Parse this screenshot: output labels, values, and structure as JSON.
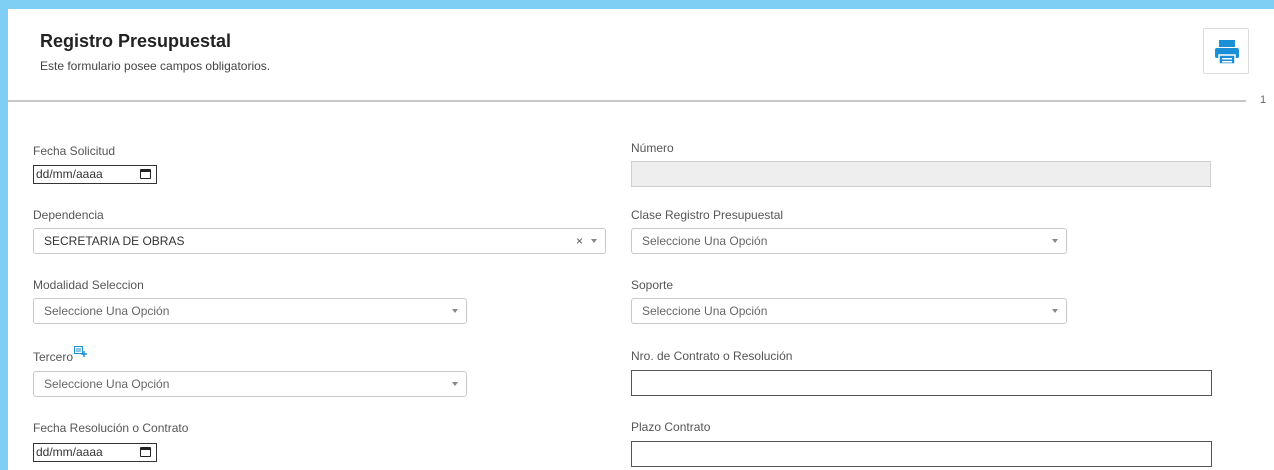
{
  "header": {
    "title": "Registro Presupuestal",
    "subtitle": "Este formulario posee campos obligatorios.",
    "page_number": "1",
    "print_icon": "printer-icon"
  },
  "form": {
    "fecha_solicitud": {
      "label": "Fecha Solicitud",
      "value": "dd/mm/aaaa"
    },
    "numero": {
      "label": "Número",
      "value": ""
    },
    "dependencia": {
      "label": "Dependencia",
      "value": "SECRETARIA DE OBRAS",
      "clear": "×"
    },
    "clase_registro": {
      "label": "Clase Registro Presupuestal",
      "value": "Seleccione Una Opción"
    },
    "modalidad": {
      "label": "Modalidad Seleccion",
      "value": "Seleccione Una Opción"
    },
    "soporte": {
      "label": "Soporte",
      "value": "Seleccione Una Opción"
    },
    "tercero": {
      "label": "Tercero",
      "value": "Seleccione Una Opción",
      "icon": "add-tercero-icon"
    },
    "nro_contrato": {
      "label": "Nro. de Contrato o Resolución",
      "value": ""
    },
    "fecha_resolucion": {
      "label": "Fecha Resolución o Contrato",
      "value": "dd/mm/aaaa"
    },
    "plazo_contrato": {
      "label": "Plazo Contrato",
      "value": ""
    }
  },
  "colors": {
    "background": "#7fcff5",
    "accent": "#1a8fd6"
  }
}
